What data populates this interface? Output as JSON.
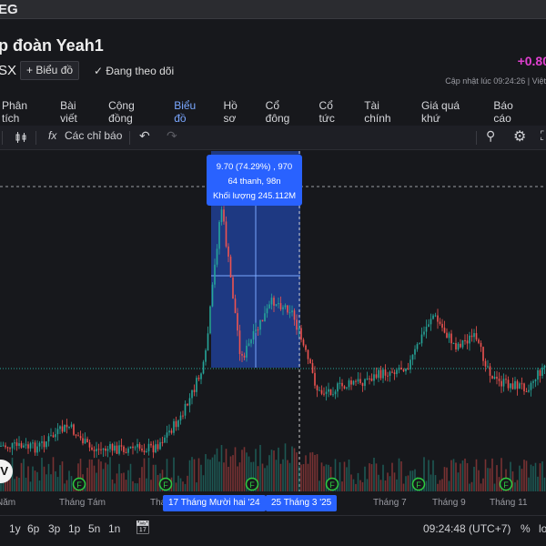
{
  "topbar": {
    "ticker": "EG"
  },
  "header": {
    "title": "p đoàn Yeah1",
    "exchange": "SX",
    "add_chart": "+ Biểu đồ",
    "following": "✓  Đang theo dõi",
    "change": "+0.80",
    "updated": "Cập nhật lúc  09:24:26 | Việt"
  },
  "tabs": [
    {
      "label": "Phân tích"
    },
    {
      "label": "Bài viết"
    },
    {
      "label": "Cộng đồng"
    },
    {
      "label": "Biểu đồ",
      "active": true
    },
    {
      "label": "Hồ sơ"
    },
    {
      "label": "Cổ đông"
    },
    {
      "label": "Cổ tức"
    },
    {
      "label": "Tài chính"
    },
    {
      "label": "Giá quá khứ"
    },
    {
      "label": "Báo cáo"
    }
  ],
  "toolbar": {
    "indicators": "Các chỉ báo",
    "fx_icon": "fx"
  },
  "tooltip": {
    "line1": "9.70 (74.29%) , 970",
    "line2": "64 thanh, 98n",
    "line3": "Khối lượng 245.112M"
  },
  "axis": {
    "labels": [
      "Năm",
      "Tháng Tám",
      "Thá",
      "Tháng 7",
      "Tháng 9",
      "Tháng 11"
    ],
    "range_start": "17 Tháng Mười hai '24",
    "range_end": "25 Tháng 3 '25"
  },
  "bottom": {
    "ranges": [
      "1y",
      "6p",
      "3p",
      "1p",
      "5n",
      "1n"
    ],
    "time": "09:24:48 (UTC+7)",
    "percent": "%",
    "log": "lo"
  },
  "logo_text": "TV",
  "events_label": "F",
  "colors": {
    "up": "#26a69a",
    "down": "#ef5350",
    "accent": "#2962ff",
    "change": "#e040d0"
  }
}
